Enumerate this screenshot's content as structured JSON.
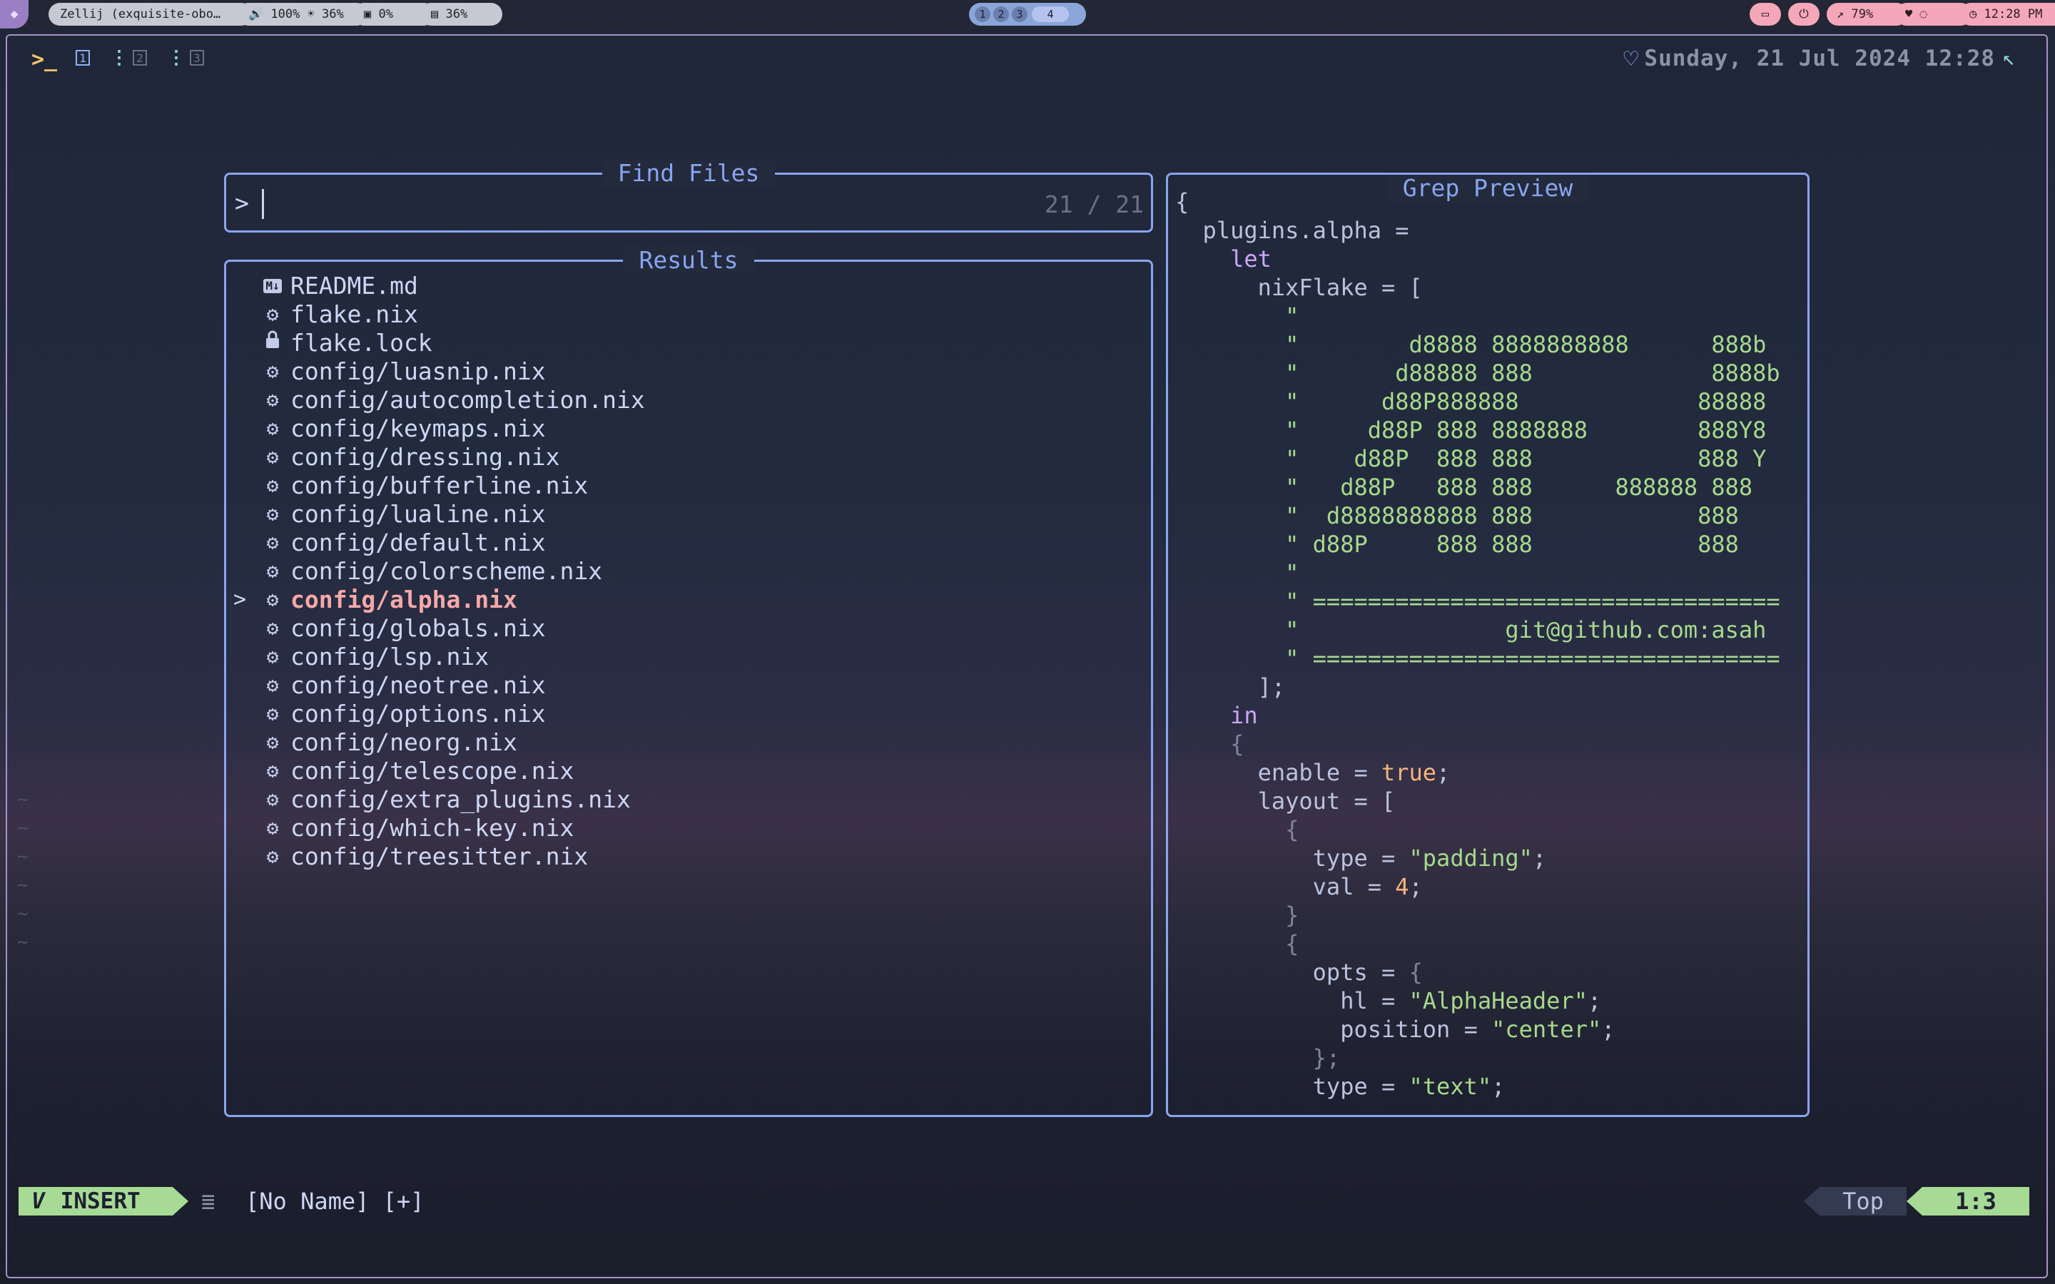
{
  "topbar": {
    "pills_left": [
      "Zellij (exquisite-obo…",
      "🔊 100% ☀ 36%",
      "▣ 0%",
      "▤ 36%"
    ],
    "workspaces": [
      "1",
      "2",
      "3",
      "4"
    ],
    "active_workspace": "4",
    "pills_right": [
      "▭",
      "⏻",
      "↗ 79%",
      "♥ ◌"
    ],
    "clock": "◷ 12:28 PM"
  },
  "terminal": {
    "prompt_symbol": ">_",
    "tabs": [
      "1",
      "2",
      "3"
    ],
    "datetime": "Sunday, 21 Jul 2024 12:28"
  },
  "telescope": {
    "prompt_title": "Find Files",
    "prompt_caret": ">",
    "query": "",
    "counter": "21 / 21",
    "results_title": "Results",
    "selection_marker": ">",
    "results": [
      {
        "icon": "markdown-icon",
        "name": "README.md"
      },
      {
        "icon": "gear-icon",
        "name": "flake.nix"
      },
      {
        "icon": "lock-icon",
        "name": "flake.lock"
      },
      {
        "icon": "gear-icon",
        "name": "config/luasnip.nix"
      },
      {
        "icon": "gear-icon",
        "name": "config/autocompletion.nix"
      },
      {
        "icon": "gear-icon",
        "name": "config/keymaps.nix"
      },
      {
        "icon": "gear-icon",
        "name": "config/dressing.nix"
      },
      {
        "icon": "gear-icon",
        "name": "config/bufferline.nix"
      },
      {
        "icon": "gear-icon",
        "name": "config/lualine.nix"
      },
      {
        "icon": "gear-icon",
        "name": "config/default.nix"
      },
      {
        "icon": "gear-icon",
        "name": "config/colorscheme.nix"
      },
      {
        "icon": "gear-icon",
        "name": "config/alpha.nix",
        "selected": true
      },
      {
        "icon": "gear-icon",
        "name": "config/globals.nix"
      },
      {
        "icon": "gear-icon",
        "name": "config/lsp.nix"
      },
      {
        "icon": "gear-icon",
        "name": "config/neotree.nix"
      },
      {
        "icon": "gear-icon",
        "name": "config/options.nix"
      },
      {
        "icon": "gear-icon",
        "name": "config/neorg.nix"
      },
      {
        "icon": "gear-icon",
        "name": "config/telescope.nix"
      },
      {
        "icon": "gear-icon",
        "name": "config/extra_plugins.nix"
      },
      {
        "icon": "gear-icon",
        "name": "config/which-key.nix"
      },
      {
        "icon": "gear-icon",
        "name": "config/treesitter.nix"
      }
    ],
    "preview_title": "Grep Preview",
    "preview_lines": [
      [
        [
          "w",
          "{"
        ]
      ],
      [
        [
          "w",
          "  plugins.alpha ="
        ]
      ],
      [
        [
          "p",
          "    let"
        ]
      ],
      [
        [
          "w",
          "      nixFlake = ["
        ]
      ],
      [
        [
          "g",
          "        \""
        ]
      ],
      [
        [
          "g",
          "        \"        d8888 8888888888      888b"
        ]
      ],
      [
        [
          "g",
          "        \"       d88888 888             8888b"
        ]
      ],
      [
        [
          "g",
          "        \"      d88P888888             88888"
        ]
      ],
      [
        [
          "g",
          "        \"     d88P 888 8888888        888Y8"
        ]
      ],
      [
        [
          "g",
          "        \"    d88P  888 888            888 Y"
        ]
      ],
      [
        [
          "g",
          "        \"   d88P   888 888      888888 888"
        ]
      ],
      [
        [
          "g",
          "        \"  d8888888888 888            888"
        ]
      ],
      [
        [
          "g",
          "        \" d88P     888 888            888"
        ]
      ],
      [
        [
          "g",
          "        \""
        ]
      ],
      [
        [
          "g",
          "        \" =================================="
        ]
      ],
      [
        [
          "g",
          "        \"               git@github.com:asah"
        ]
      ],
      [
        [
          "g",
          "        \" =================================="
        ]
      ],
      [
        [
          "w",
          "      ];"
        ]
      ],
      [
        [
          "p",
          "    in"
        ]
      ],
      [
        [
          "d",
          "    {"
        ]
      ],
      [
        [
          "w",
          "      enable = "
        ],
        [
          "o",
          "true"
        ],
        [
          "w",
          ";"
        ]
      ],
      [
        [
          "w",
          "      layout = ["
        ]
      ],
      [
        [
          "d",
          "        {"
        ]
      ],
      [
        [
          "w",
          "          type = "
        ],
        [
          "g",
          "\"padding\""
        ],
        [
          "w",
          ";"
        ]
      ],
      [
        [
          "w",
          "          val = "
        ],
        [
          "o",
          "4"
        ],
        [
          "w",
          ";"
        ]
      ],
      [
        [
          "d",
          "        }"
        ]
      ],
      [
        [
          "d",
          "        {"
        ]
      ],
      [
        [
          "w",
          "          opts = "
        ],
        [
          "d",
          "{"
        ]
      ],
      [
        [
          "w",
          "            hl = "
        ],
        [
          "g",
          "\"AlphaHeader\""
        ],
        [
          "w",
          ";"
        ]
      ],
      [
        [
          "w",
          "            position = "
        ],
        [
          "g",
          "\"center\""
        ],
        [
          "w",
          ";"
        ]
      ],
      [
        [
          "d",
          "          };"
        ]
      ],
      [
        [
          "w",
          "          type = "
        ],
        [
          "g",
          "\"text\""
        ],
        [
          "w",
          ";"
        ]
      ]
    ]
  },
  "statusline": {
    "mode": "INSERT",
    "mode_icon": "V",
    "filename": "[No Name] [+]",
    "scroll": "Top",
    "position": "1:3"
  },
  "colors": {
    "accent": "#89a5f0",
    "mode_bg": "#a6da95",
    "selected": "#f5a8a8",
    "string": "#a6d98d",
    "keyword": "#cba6f7",
    "number": "#f5b47c"
  }
}
